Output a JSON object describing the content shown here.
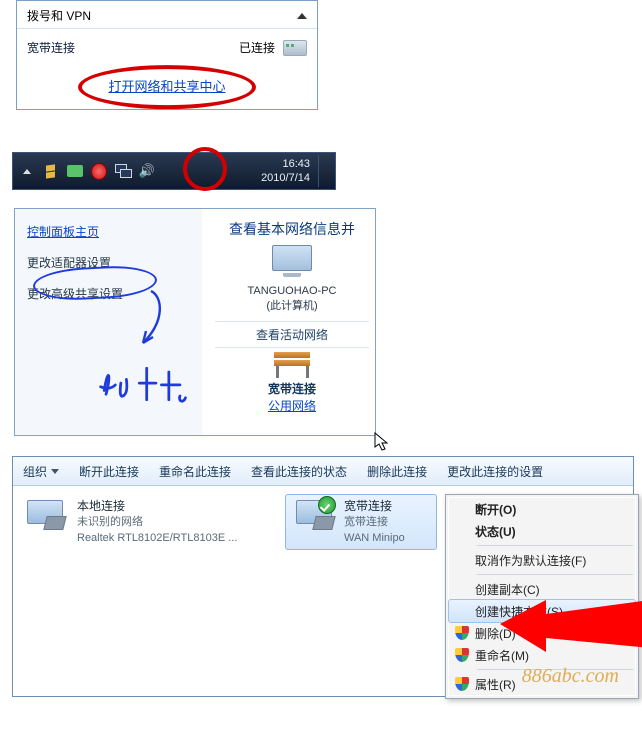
{
  "flyout": {
    "section_title": "拨号和 VPN",
    "connection_name": "宽带连接",
    "connection_status": "已连接",
    "open_center_link": "打开网络和共享中心"
  },
  "taskbar": {
    "time": "16:43",
    "date": "2010/7/14"
  },
  "control_panel": {
    "home_link": "控制面板主页",
    "change_adapter": "更改适配器设置",
    "change_sharing": "更改高级共享设置",
    "annotation": "点 击",
    "heading": "查看基本网络信息并",
    "pc_name": "TANGUOHAO-PC",
    "pc_subtitle": "(此计算机)",
    "active_net_heading": "查看活动网络",
    "bench_title": "宽带连接",
    "bench_link": "公用网络"
  },
  "explorer": {
    "toolbar": {
      "organize": "组织",
      "disconnect": "断开此连接",
      "rename": "重命名此连接",
      "status": "查看此连接的状态",
      "delete": "删除此连接",
      "change": "更改此连接的设置"
    },
    "items": [
      {
        "name": "本地连接",
        "line2": "未识别的网络",
        "line3": "Realtek RTL8102E/RTL8103E ..."
      },
      {
        "name": "宽带连接",
        "line2": "宽带连接",
        "line3": "WAN Minipo"
      }
    ]
  },
  "context_menu": {
    "disconnect": "断开(O)",
    "status": "状态(U)",
    "unset_default": "取消作为默认连接(F)",
    "copy": "创建副本(C)",
    "shortcut": "创建快捷方式(S)",
    "delete": "删除(D)",
    "rename": "重命名(M)",
    "properties": "属性(R)"
  },
  "watermark": "886abc.com"
}
